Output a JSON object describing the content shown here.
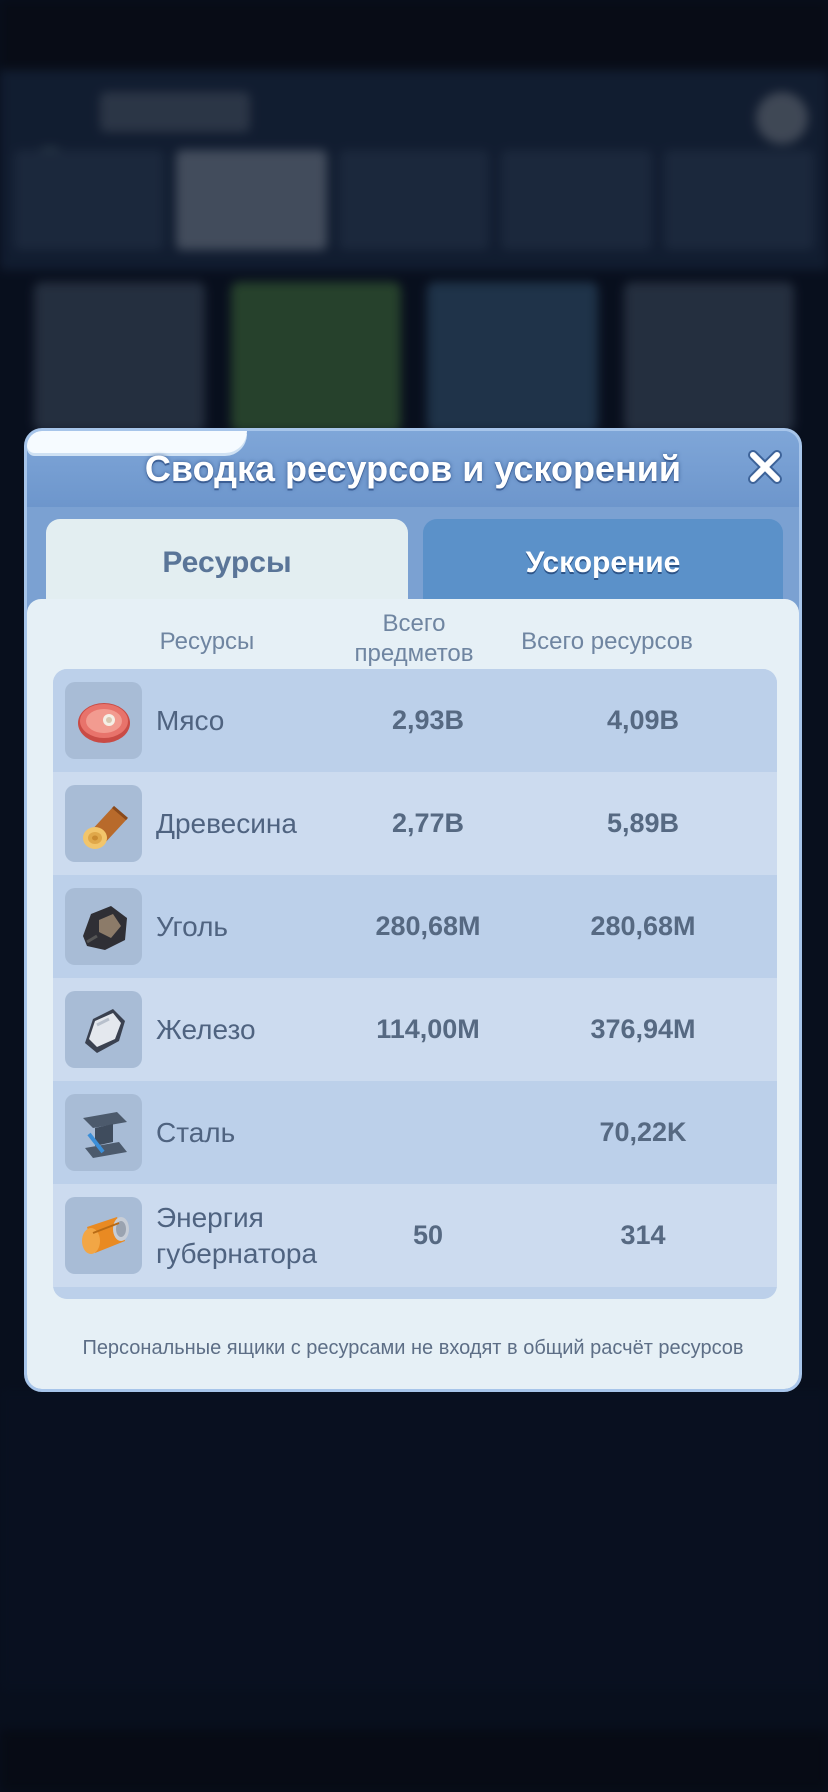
{
  "dialog": {
    "title": "Сводка ресурсов и ускорений",
    "close_icon": "close-icon"
  },
  "tabs": [
    {
      "label": "Ресурсы",
      "active": true
    },
    {
      "label": "Ускорение",
      "active": false
    }
  ],
  "columns": {
    "resource": "Ресурсы",
    "items": "Всего предметов",
    "total": "Всего ресурсов"
  },
  "rows": [
    {
      "icon": "meat-icon",
      "name": "Мясо",
      "items": "2,93B",
      "total": "4,09B"
    },
    {
      "icon": "wood-icon",
      "name": "Древесина",
      "items": "2,77B",
      "total": "5,89B"
    },
    {
      "icon": "coal-icon",
      "name": "Уголь",
      "items": "280,68M",
      "total": "280,68M"
    },
    {
      "icon": "iron-icon",
      "name": "Железо",
      "items": "114,00M",
      "total": "376,94M"
    },
    {
      "icon": "steel-icon",
      "name": "Сталь",
      "items": "",
      "total": "70,22K"
    },
    {
      "icon": "energy-can-icon",
      "name": "Энергия губернатора",
      "items": "50",
      "total": "314"
    }
  ],
  "footnote": "Персональные ящики с ресурсами не входят в общий расчёт ресурсов",
  "colors": {
    "header": "#6d96cc",
    "tab_active": "#e3eef1",
    "tab_inactive": "#5b91c9",
    "panel": "#e6f0f6",
    "row_dark": "#bcd0ea",
    "row_light": "#ccdbef"
  }
}
